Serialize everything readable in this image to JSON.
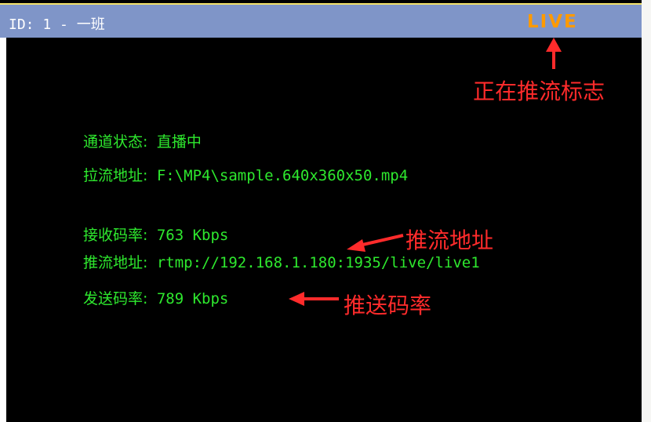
{
  "header": {
    "title": "ID: 1 - 一班",
    "live_badge": "LIVE"
  },
  "info": {
    "channel_status_label": "通道状态:",
    "channel_status_value": "直播中",
    "pull_url_label": "拉流地址:",
    "pull_url_value": "F:\\MP4\\sample.640x360x50.mp4",
    "receive_bitrate_label": "接收码率:",
    "receive_bitrate_value": "763 Kbps",
    "push_url_label": "推流地址:",
    "push_url_value": "rtmp://192.168.1.180:1935/live/live1",
    "send_bitrate_label": "发送码率:",
    "send_bitrate_value": "789 Kbps"
  },
  "annotations": {
    "live_flag": "正在推流标志",
    "push_url": "推流地址",
    "send_bitrate": "推送码率"
  },
  "colors": {
    "title_bar": "#7f95c8",
    "live": "#ff9a00",
    "info_text": "#2ee82e",
    "annotation": "#ff2b2b",
    "background": "#000000"
  }
}
